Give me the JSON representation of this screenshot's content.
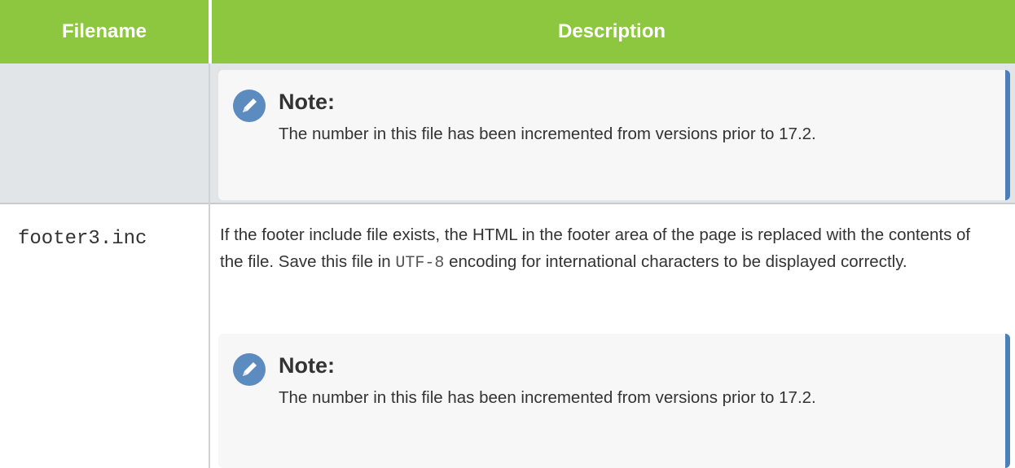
{
  "header": {
    "filename_label": "Filename",
    "description_label": "Description"
  },
  "rows": [
    {
      "filename": "",
      "note": {
        "title": "Note:",
        "body": "The number in this file has been incremented from versions prior to 17.2."
      }
    },
    {
      "filename": "footer3.inc",
      "description_part1": "If the footer include file exists, the HTML in the footer area of the page is replaced with the contents of the file. Save this file in ",
      "description_code": "UTF-8",
      "description_part2": " encoding for international characters to be displayed correctly.",
      "note": {
        "title": "Note:",
        "body": "The number in this file has been incremented from versions prior to 17.2."
      }
    }
  ],
  "colors": {
    "header_bg": "#8dc63f",
    "note_border": "#4a7fb7",
    "icon_bg": "#5b8bbf"
  },
  "icons": {
    "note_icon": "pencil-icon"
  }
}
